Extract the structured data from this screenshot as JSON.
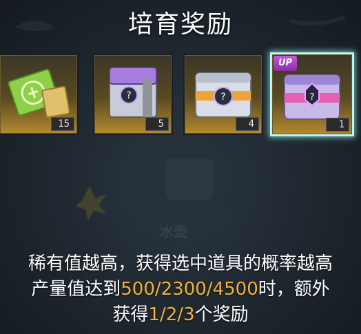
{
  "title": "培育奖励",
  "items": [
    {
      "icon": "green-ticket-icon",
      "count": "15",
      "selected": false
    },
    {
      "icon": "purple-mystery-box-icon",
      "count": "5",
      "selected": false
    },
    {
      "icon": "orange-mystery-chest-icon",
      "count": "4",
      "selected": false
    },
    {
      "icon": "pink-mystery-chest-icon",
      "count": "1",
      "selected": true,
      "badge": "UP"
    }
  ],
  "background_label": "水壶",
  "description": {
    "line1": "稀有值越高，获得选中道具的概率越高",
    "line2_prefix": "产量值达到",
    "line2_highlight": "500/2300/4500",
    "line2_suffix": "时，额外",
    "line3_prefix": "获得",
    "line3_highlight": "1/2/3",
    "line3_suffix": "个奖励"
  },
  "colors": {
    "highlight": "#f0b23c",
    "selected_border": "#bff6f2",
    "background": "#1e262e"
  }
}
